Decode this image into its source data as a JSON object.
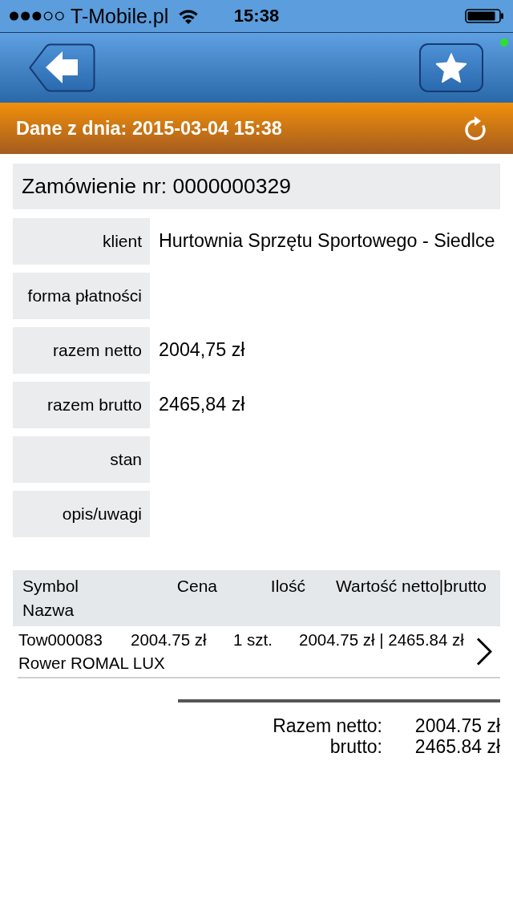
{
  "status_bar": {
    "carrier": "T-Mobile.pl",
    "time": "15:38"
  },
  "info_bar": {
    "text": "Dane z dnia: 2015-03-04 15:38"
  },
  "order": {
    "title": "Zamówienie nr: 0000000329",
    "fields": [
      {
        "label": "klient",
        "value": "Hurtownia Sprzętu Sportowego - Siedlce"
      },
      {
        "label": "forma płatności"
      },
      {
        "label": "razem netto",
        "value": "2004,75 zł"
      },
      {
        "label": "razem brutto",
        "value": "2465,84 zł"
      },
      {
        "label": "stan"
      },
      {
        "label": "opis/uwagi"
      }
    ]
  },
  "table": {
    "columns": [
      "Symbol",
      "Cena",
      "Ilość",
      "Wartość netto|brutto"
    ],
    "second_line_column": "Nazwa",
    "rows": [
      {
        "symbol": "Tow000083",
        "price": "2004.75 zł",
        "quantity": "1 szt.",
        "value": "2004.75 zł | 2465.84 zł",
        "name": "Rower ROMAL LUX"
      }
    ]
  },
  "totals": [
    {
      "label": "Razem netto:",
      "value": "2004.75 zł"
    },
    {
      "label": "brutto:",
      "value": "2465.84 zł"
    }
  ]
}
